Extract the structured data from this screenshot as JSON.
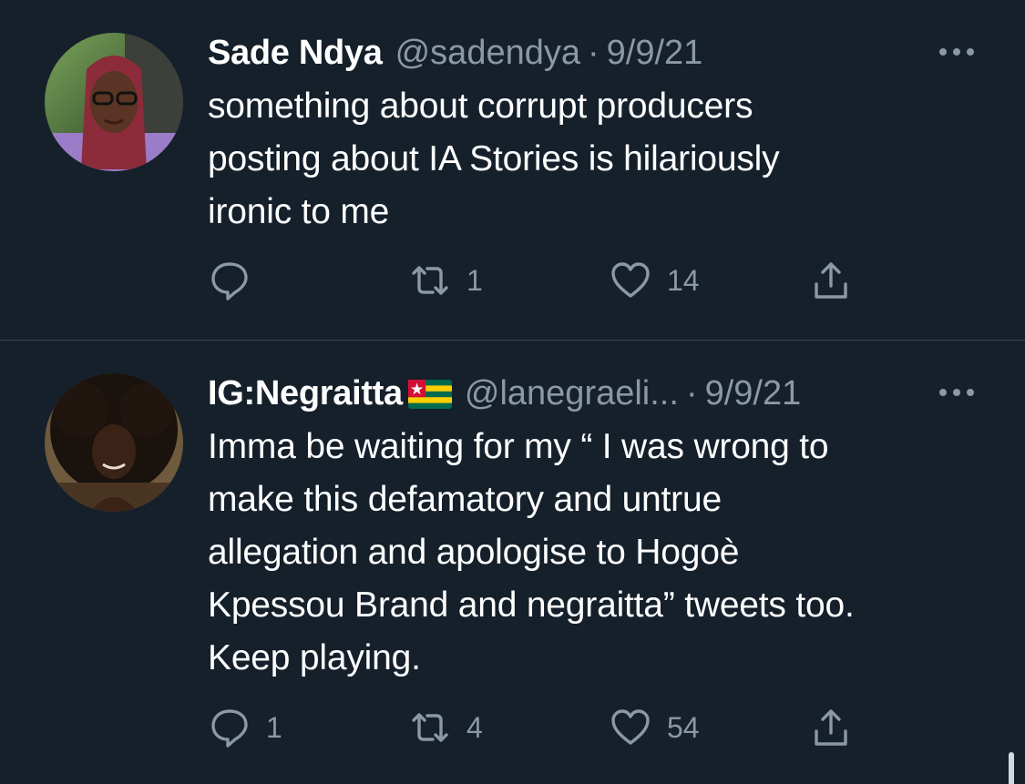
{
  "tweets": [
    {
      "author_name": "Sade Ndya",
      "handle": "@sadendya",
      "separator": "·",
      "date": "9/9/21",
      "text": "something about corrupt producers\nposting about IA Stories is hilariously\nironic to me",
      "reply_count": "",
      "retweet_count": "1",
      "like_count": "14"
    },
    {
      "author_name": "IG:Negraitta",
      "handle": "@lanegraeli...",
      "separator": "·",
      "date": "9/9/21",
      "text": "Imma be waiting for my “ I was wrong to\nmake this defamatory and untrue\nallegation and apologise to Hogoè\nKpessou Brand and negraitta” tweets too.\nKeep playing.",
      "reply_count": "1",
      "retweet_count": "4",
      "like_count": "54"
    }
  ],
  "icons": {
    "reply": "reply-icon",
    "retweet": "retweet-icon",
    "like": "heart-icon",
    "share": "share-icon",
    "more": "more-icon",
    "flag": "togo-flag-icon"
  },
  "colors": {
    "background": "#15202b",
    "text_primary": "#ffffff",
    "text_secondary": "#8b98a5",
    "divider": "#38444d"
  }
}
